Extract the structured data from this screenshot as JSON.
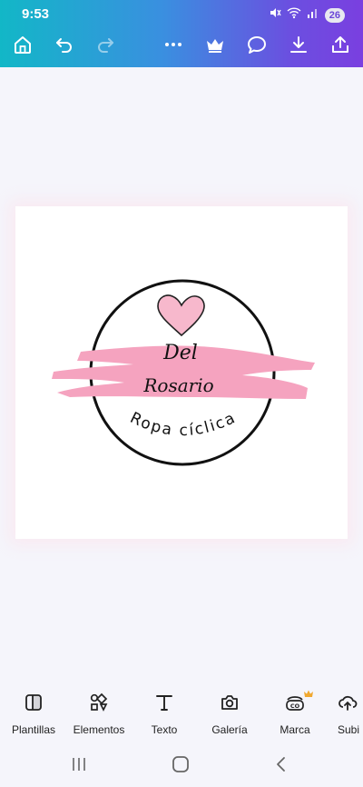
{
  "status": {
    "time": "9:53",
    "battery": "26"
  },
  "toolbar": {
    "icons": [
      "home-icon",
      "undo-icon",
      "redo-icon",
      "more-icon",
      "crown-icon",
      "comment-icon",
      "download-icon",
      "share-icon"
    ]
  },
  "design": {
    "heart_color": "#f7b8cc",
    "brush_color": "#f5a3bf",
    "title_line1": "Del",
    "title_line2": "Rosario",
    "subtitle": "Ropa cíclica"
  },
  "bottom_nav": {
    "items": [
      {
        "label": "Plantillas",
        "icon": "templates-icon"
      },
      {
        "label": "Elementos",
        "icon": "elements-icon"
      },
      {
        "label": "Texto",
        "icon": "text-icon"
      },
      {
        "label": "Galería",
        "icon": "camera-icon"
      },
      {
        "label": "Marca",
        "icon": "brand-icon"
      },
      {
        "label": "Subi",
        "icon": "upload-icon"
      }
    ]
  },
  "colors": {
    "accent_crown": "#f0a830",
    "gradient_start": "#12b7c7",
    "gradient_end": "#7a3fe0"
  }
}
